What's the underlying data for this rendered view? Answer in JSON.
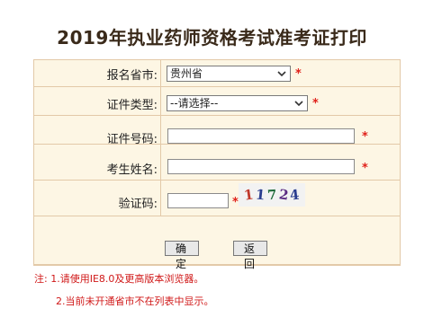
{
  "page_title": "2019年执业药师资格考试准考证打印",
  "form": {
    "province_label": "报名省市:",
    "province_value": "贵州省",
    "id_type_label": "证件类型:",
    "id_type_value": "--请选择--",
    "id_number_label": "证件号码:",
    "id_number_value": "",
    "name_label": "考生姓名:",
    "name_value": "",
    "captcha_label": "验证码:",
    "captcha_value": "",
    "captcha_text": [
      "1",
      "1",
      "7",
      "2",
      "4"
    ],
    "required_mark": "*"
  },
  "buttons": {
    "confirm": "确 定",
    "back": "返 回"
  },
  "notes": {
    "line1": "注: 1.请使用IE8.0及更高版本浏览器。",
    "line2": "2.当前未开通省市不在列表中显示。"
  },
  "colors": {
    "required": "#e0201a",
    "note_text": "#d01818",
    "form_bg": "#fdf6e4",
    "border": "#e3c9a8"
  },
  "icons": {
    "select_arrow": "chevron-down-icon"
  }
}
